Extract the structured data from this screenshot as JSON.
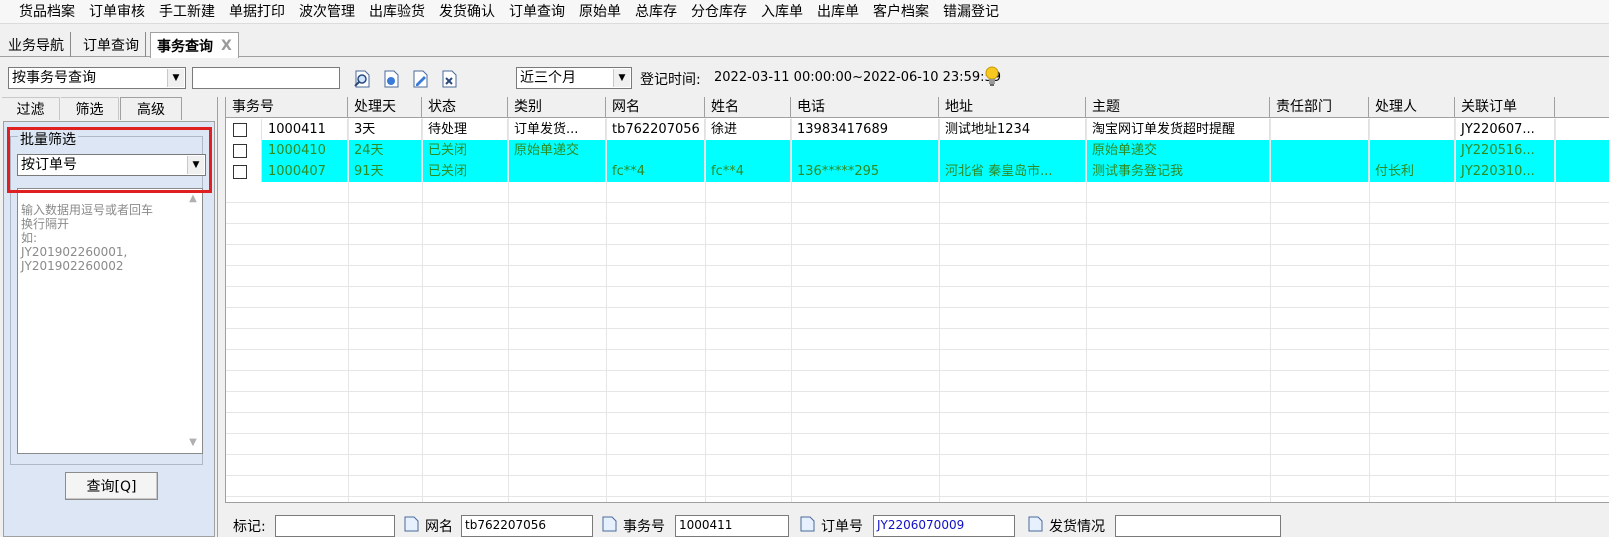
{
  "menu": [
    "货品档案",
    "订单审核",
    "手工新建",
    "单据打印",
    "波次管理",
    "出库验货",
    "发货确认",
    "订单查询",
    "原始单",
    "总库存",
    "分仓库存",
    "入库单",
    "出库单",
    "客户档案",
    "错漏登记"
  ],
  "tabs": [
    {
      "label": "业务导航"
    },
    {
      "label": "订单查询"
    },
    {
      "label": "事务查询",
      "close": "X"
    }
  ],
  "toolbar": {
    "search_mode": "按事务号查询",
    "search_value": "",
    "period": "近三个月",
    "reg_time_label": "登记时间:",
    "reg_time_value": "2022-03-11 00:00:00~2022-06-10 23:59:59"
  },
  "left": {
    "tabs": [
      "过滤",
      "筛选",
      "高级"
    ],
    "group_title": "批量筛选",
    "filter_select": "按订单号",
    "placeholder": "输入数据用逗号或者回车\n换行隔开\n如:\nJY201902260001,\nJY201902260002",
    "query_button": "查询[Q]"
  },
  "grid": {
    "columns": [
      "事务号",
      "处理天",
      "状态",
      "类别",
      "网名",
      "姓名",
      "电话",
      "地址",
      "主题",
      "责任部门",
      "处理人",
      "关联订单"
    ],
    "rows": [
      {
        "cells": [
          "1000411",
          "3天",
          "待处理",
          "订单发货...",
          "tb762207056",
          "徐进",
          "13983417689",
          "测试地址1234",
          "淘宝网订单发货超时提醒",
          "",
          "",
          "JY220607..."
        ],
        "highlight": false
      },
      {
        "cells": [
          "1000410",
          "24天",
          "已关闭",
          "原始单递交",
          "",
          "",
          "",
          "",
          "原始单递交",
          "",
          "",
          "JY220516..."
        ],
        "highlight": true
      },
      {
        "cells": [
          "1000407",
          "91天",
          "已关闭",
          "",
          "fc**4",
          "fc**4",
          "136*****295",
          "河北省 秦皇岛市...",
          "测试事务登记我",
          "",
          "付长利",
          "JY220310..."
        ],
        "highlight": true
      }
    ],
    "highlight_color": "#00ffff",
    "highlight_text_color": "#2e8b22"
  },
  "bottom": {
    "mark_label": "标记:",
    "mark_value": "",
    "nick_label": "网名",
    "nick_value": "tb762207056",
    "txn_label": "事务号",
    "txn_value": "1000411",
    "order_label": "订单号",
    "order_value": "JY2206070009",
    "ship_label": "发货情况",
    "ship_value": ""
  },
  "icons": [
    "search-icon",
    "add-icon",
    "edit-icon",
    "delete-icon",
    "lightbulb-icon",
    "doc-icon"
  ]
}
